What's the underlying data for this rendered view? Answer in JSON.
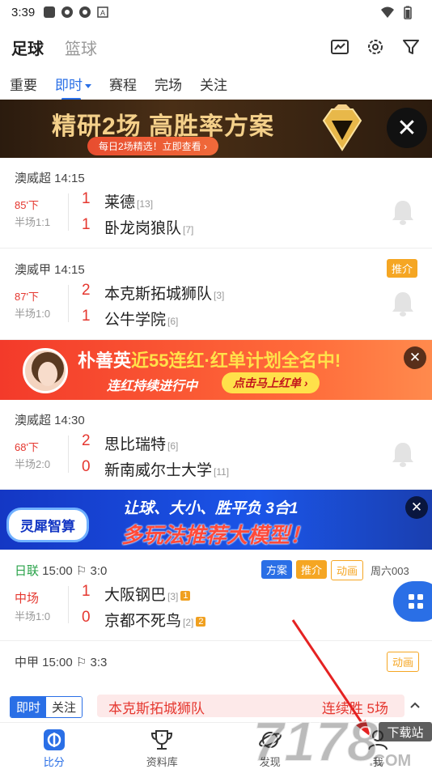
{
  "statusbar": {
    "time": "3:39"
  },
  "header": {
    "tabs": [
      {
        "label": "足球"
      },
      {
        "label": "篮球"
      }
    ]
  },
  "subtabs": [
    {
      "label": "重要"
    },
    {
      "label": "即时"
    },
    {
      "label": "赛程"
    },
    {
      "label": "完场"
    },
    {
      "label": "关注"
    }
  ],
  "banner1": {
    "title": "精研2场 高胜率方案",
    "pill": "每日2场精选！立即查看 ›",
    "close": "✕"
  },
  "matches": [
    {
      "league": "澳威超 14:15",
      "status": "85'下",
      "half": "半场1:1",
      "home": {
        "score": "1",
        "name": "莱德",
        "rank": "[13]"
      },
      "away": {
        "score": "1",
        "name": "卧龙岗狼队",
        "rank": "[7]"
      }
    },
    {
      "league": "澳威甲 14:15",
      "status": "87'下",
      "half": "半场1:0",
      "tag": "推介",
      "home": {
        "score": "2",
        "name": "本克斯拓城狮队",
        "rank": "[3]"
      },
      "away": {
        "score": "1",
        "name": "公牛学院",
        "rank": "[6]"
      }
    },
    {
      "league": "澳威超 14:30",
      "status": "68'下",
      "half": "半场2:0",
      "home": {
        "score": "2",
        "name": "思比瑞特",
        "rank": "[6]"
      },
      "away": {
        "score": "0",
        "name": "新南威尔士大学",
        "rank": "[11]"
      }
    },
    {
      "league_name": "日联",
      "league_rest": " 15:00 ⚐ 3:0",
      "status": "中场",
      "half": "半场1:0",
      "tags": [
        "方案",
        "推介",
        "动画"
      ],
      "code": "周六003",
      "home": {
        "score": "1",
        "name": "大阪钢巴",
        "rank": "[3]",
        "card": "1"
      },
      "away": {
        "score": "0",
        "name": "京都不死鸟",
        "rank": "[2]",
        "card": "2"
      }
    },
    {
      "league": "中甲 15:00 ⚐ 3:3",
      "tag": "动画"
    }
  ],
  "banner2": {
    "name": "朴善英",
    "mid": "近55连红·红单计划",
    "end": "全名中!",
    "line2": "连红持续进行中",
    "cta": "点击马上红单 ›",
    "close": "✕"
  },
  "banner3": {
    "chip": "灵犀智算",
    "line1": "让球、大小、胜平负 3合1",
    "line2": "多玩法推荐大模型！",
    "close": "✕"
  },
  "ticker": {
    "tabs": [
      {
        "label": "即时"
      },
      {
        "label": "关注"
      }
    ],
    "team": "本克斯拓城狮队",
    "streak": "连续胜 5场"
  },
  "bottomnav": [
    {
      "label": "比分"
    },
    {
      "label": "资料库"
    },
    {
      "label": "发现"
    },
    {
      "label": "我"
    }
  ],
  "watermark": {
    "text": "下载站",
    "brand": "7178",
    "com": ".COM"
  },
  "colors": {
    "accent": "#2a6fe6",
    "red": "#e5372f",
    "orange": "#f5a623"
  }
}
